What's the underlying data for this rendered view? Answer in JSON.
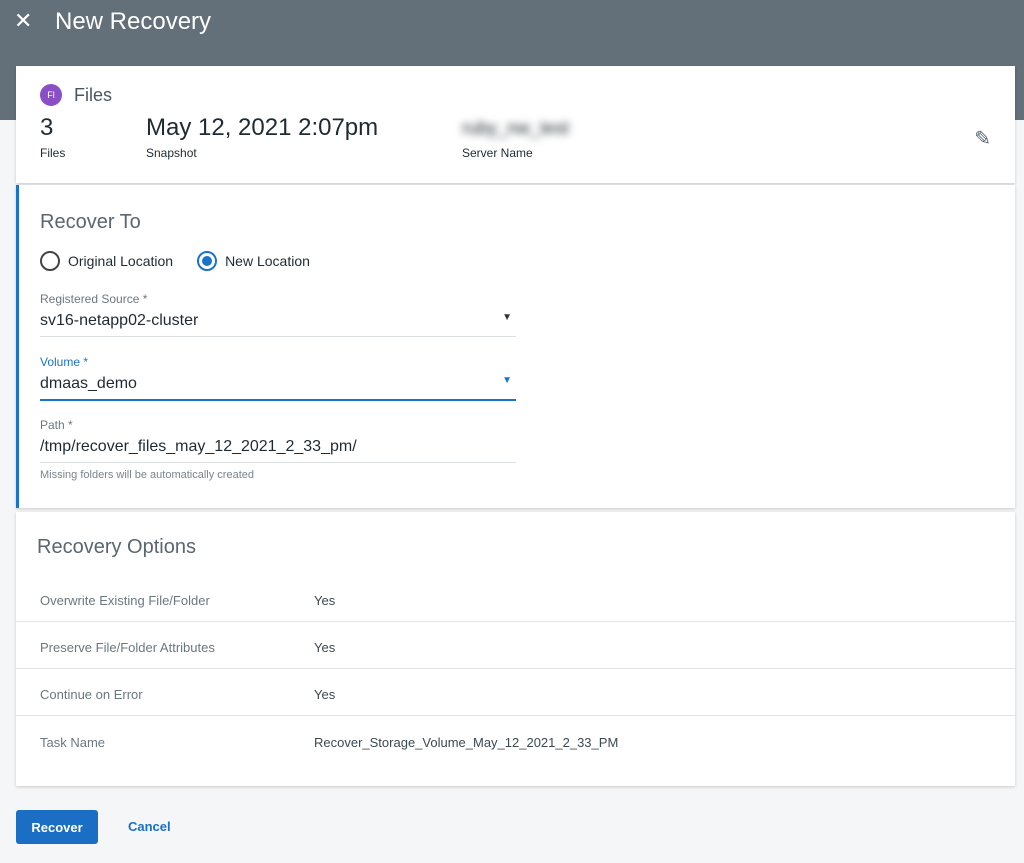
{
  "header": {
    "title": "New Recovery",
    "close_icon": "close-icon"
  },
  "summary": {
    "badge": "Fl",
    "type": "Files",
    "files_count": "3",
    "files_label": "Files",
    "snapshot": "May 12, 2021 2:07pm",
    "snapshot_label": "Snapshot",
    "server_name": "ruby_nw_test",
    "server_label": "Server Name",
    "edit_icon": "pencil-icon"
  },
  "recover_to": {
    "title": "Recover To",
    "options": [
      {
        "label": "Original Location",
        "selected": false
      },
      {
        "label": "New Location",
        "selected": true
      }
    ],
    "registered_source": {
      "label": "Registered Source *",
      "value": "sv16-netapp02-cluster"
    },
    "volume": {
      "label": "Volume *",
      "value": "dmaas_demo"
    },
    "path": {
      "label": "Path *",
      "value": "/tmp/recover_files_may_12_2021_2_33_pm/",
      "hint": "Missing folders will be automatically created"
    }
  },
  "recovery_options": {
    "title": "Recovery Options",
    "rows": [
      {
        "key": "Overwrite Existing File/Folder",
        "value": "Yes"
      },
      {
        "key": "Preserve File/Folder Attributes",
        "value": "Yes"
      },
      {
        "key": "Continue on Error",
        "value": "Yes"
      },
      {
        "key": "Task Name",
        "value": "Recover_Storage_Volume_May_12_2021_2_33_PM"
      }
    ]
  },
  "actions": {
    "recover": "Recover",
    "cancel": "Cancel"
  },
  "colors": {
    "accent": "#1a73c8",
    "header": "#637079"
  }
}
